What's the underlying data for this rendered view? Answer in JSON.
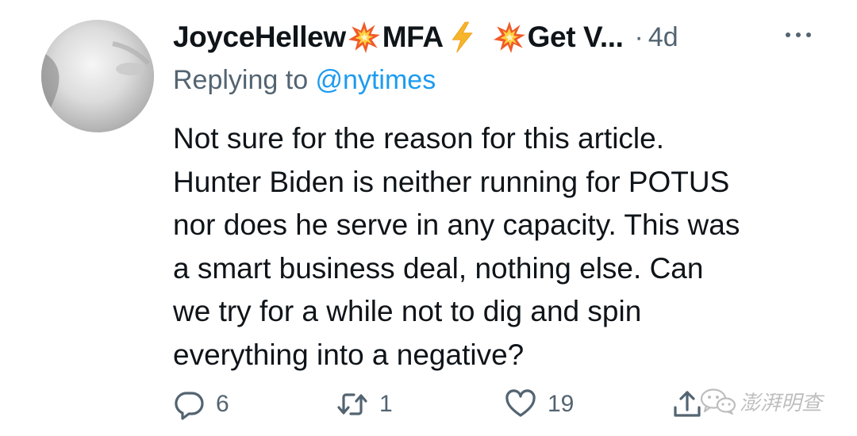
{
  "tweet": {
    "author": {
      "name_parts": [
        "JoyceHellew",
        "MFA",
        "Get V..."
      ],
      "name_emojis": [
        "collision-emoji",
        "high-voltage-emoji",
        "collision-emoji"
      ]
    },
    "separator": "·",
    "timestamp": "4d",
    "replying_prefix": "Replying to ",
    "replying_handle": "@nytimes",
    "text_lines": [
      "Not sure for the reason for this article.",
      "Hunter Biden is neither running for POTUS",
      "nor does he serve in any capacity. This was",
      "a smart business deal, nothing else. Can",
      "we try for a while not to dig and spin",
      "everything into a negative?"
    ],
    "actions": {
      "reply_count": "6",
      "retweet_count": "1",
      "like_count": "19"
    }
  },
  "watermark": {
    "text": "澎湃明查",
    "icon": "wechat-icon"
  },
  "colors": {
    "text_primary": "#0f1419",
    "text_secondary": "#536471",
    "link": "#1d9bf0",
    "collision_emoji": "#f05a28",
    "voltage_emoji": "#f7b52c"
  }
}
